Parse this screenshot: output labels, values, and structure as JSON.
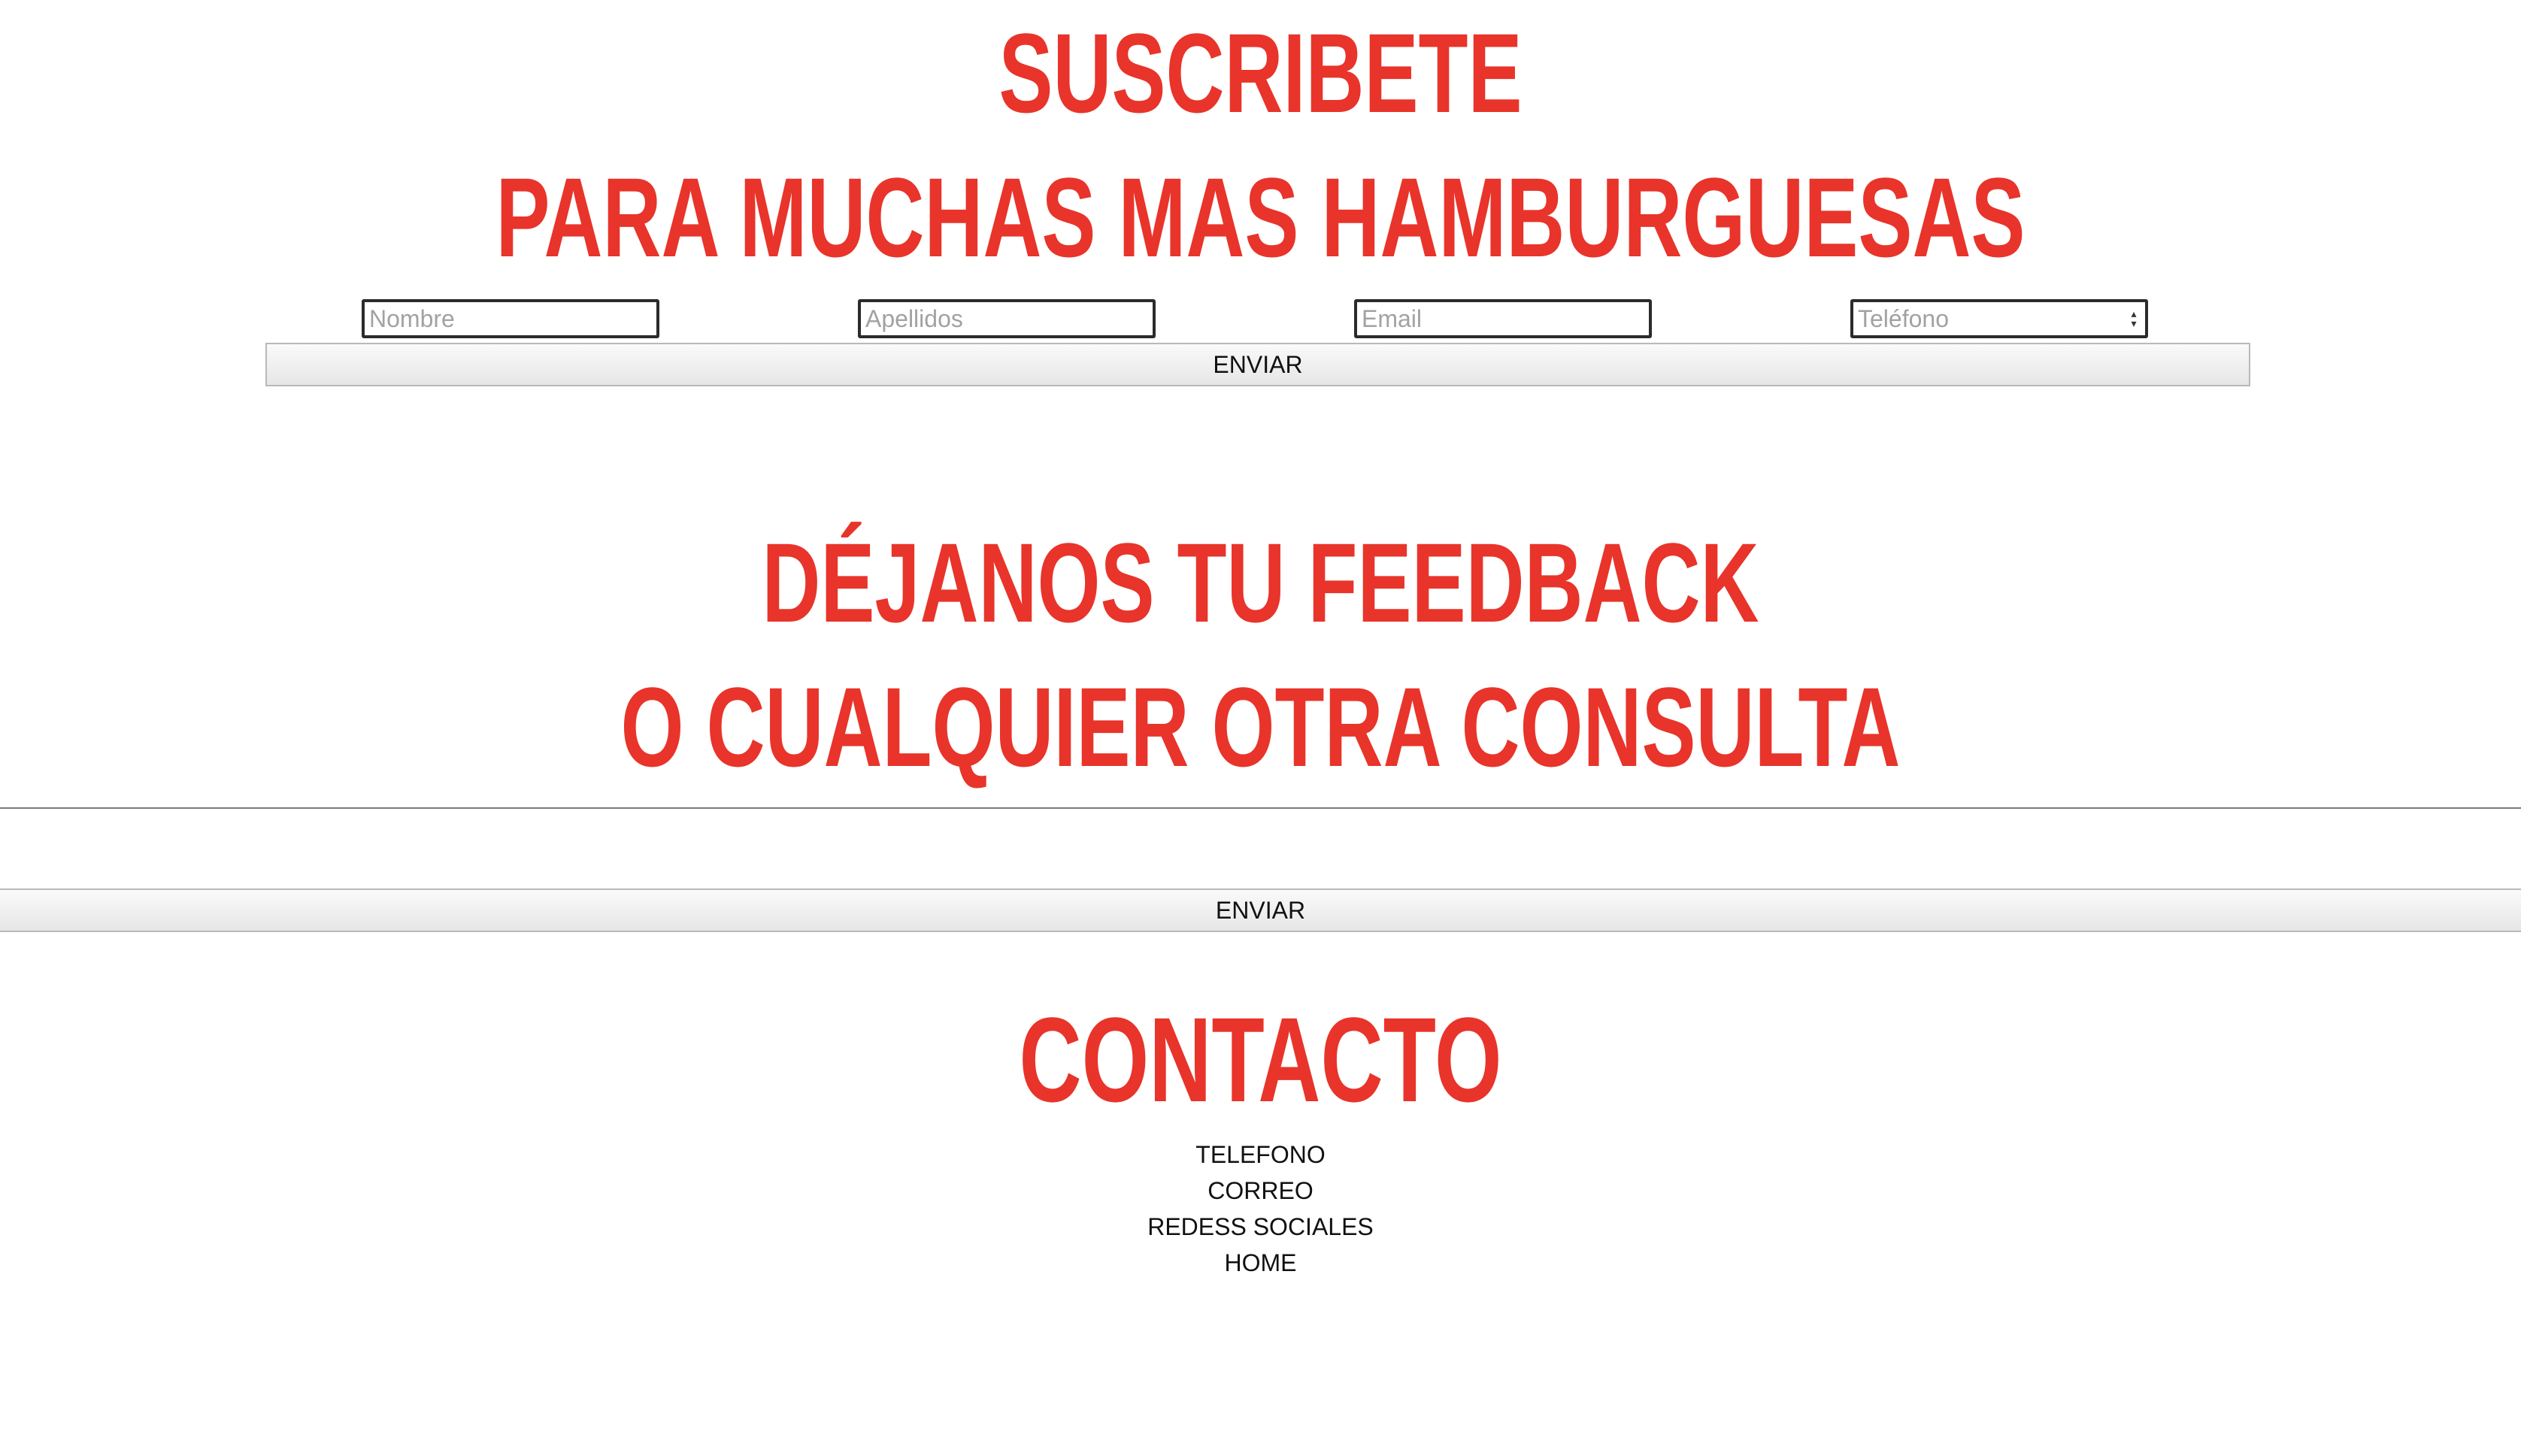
{
  "subscribe": {
    "title_line1": "SUSCRIBETE",
    "title_line2": "PARA MUCHAS MAS HAMBURGUESAS",
    "fields": {
      "nombre_placeholder": "Nombre",
      "apellidos_placeholder": "Apellidos",
      "email_placeholder": "Email",
      "telefono_placeholder": "Teléfono"
    },
    "submit_label": "ENVIAR"
  },
  "feedback": {
    "title_line1": "DÉJANOS TU FEEDBACK",
    "title_line2": "O CUALQUIER OTRA CONSULTA",
    "submit_label": "ENVIAR"
  },
  "contact": {
    "title": "CONTACTO",
    "links": {
      "telefono": "TELEFONO",
      "correo": "CORREO",
      "redes": "REDESS SOCIALES",
      "home": "HOME"
    }
  },
  "colors": {
    "heading": "#e8342a",
    "text": "#111111",
    "background": "#ffffff"
  },
  "icons": {
    "number_stepper": "up-down-arrows-icon"
  }
}
